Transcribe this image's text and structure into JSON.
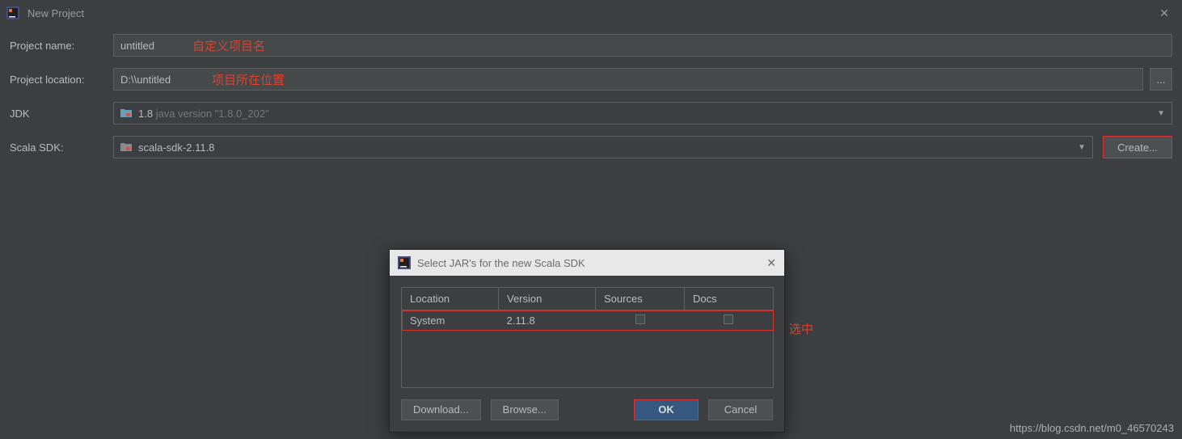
{
  "window": {
    "title": "New Project"
  },
  "form": {
    "project_name_label": "Project name:",
    "project_name_value": "untitled",
    "project_location_label": "Project location:",
    "project_location_value": "D:\\\\untitled",
    "browse_dots": "...",
    "jdk_label": "JDK",
    "jdk_value_main": "1.8",
    "jdk_value_sub": " java version \"1.8.0_202\"",
    "scala_sdk_label": "Scala SDK:",
    "scala_sdk_value": "scala-sdk-2.11.8",
    "create_button": "Create..."
  },
  "annotations": {
    "name_hint": "自定义项目名",
    "location_hint": "项目所在位置",
    "select_hint": "选中"
  },
  "dialog": {
    "title": "Select JAR's for the new Scala SDK",
    "columns": [
      "Location",
      "Version",
      "Sources",
      "Docs"
    ],
    "row": {
      "location": "System",
      "version": "2.11.8"
    },
    "download": "Download...",
    "browse": "Browse...",
    "ok": "OK",
    "cancel": "Cancel"
  },
  "watermark": "https://blog.csdn.net/m0_46570243"
}
